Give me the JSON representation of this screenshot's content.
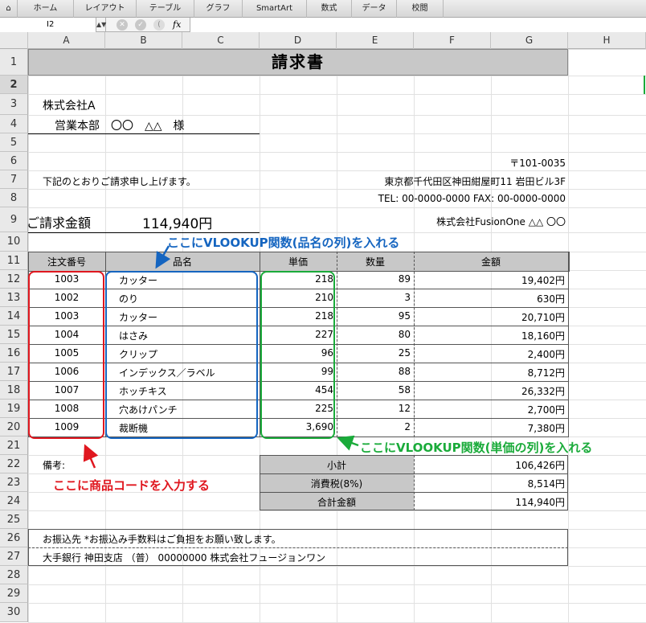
{
  "ribbon": {
    "tabs": [
      "ホーム",
      "レイアウト",
      "テーブル",
      "グラフ",
      "SmartArt",
      "数式",
      "データ",
      "校閲"
    ]
  },
  "formula_bar": {
    "cell_ref": "I2",
    "formula": ""
  },
  "columns": [
    "A",
    "B",
    "C",
    "D",
    "E",
    "F",
    "G",
    "H"
  ],
  "rows": [
    "1",
    "2",
    "3",
    "4",
    "5",
    "6",
    "7",
    "8",
    "9",
    "10",
    "11",
    "12",
    "13",
    "14",
    "15",
    "16",
    "17",
    "18",
    "19",
    "20",
    "21",
    "22",
    "23",
    "24",
    "25",
    "26",
    "27",
    "28",
    "29",
    "30"
  ],
  "selected_row": "2",
  "invoice": {
    "title": "請求書",
    "client_company": "株式会社A",
    "client_dept": "営業本部　〇〇　△△　様",
    "postal": "〒101-0035",
    "intro": "下記のとおりご請求申し上げます。",
    "address": "東京都千代田区神田紺屋町11  岩田ビル3F",
    "tel_fax": "TEL: 00-0000-0000 FAX: 00-0000-0000",
    "total_label": "ご請求金額",
    "total_value": "114,940円",
    "issuer": "株式会社FusionOne  △△  〇〇",
    "headers": {
      "order": "注文番号",
      "name": "品名",
      "price": "単価",
      "qty": "数量",
      "amount": "金額"
    },
    "items": [
      {
        "order": "1003",
        "name": "カッター",
        "price": "218",
        "qty": "89",
        "amount": "19,402円"
      },
      {
        "order": "1002",
        "name": "のり",
        "price": "210",
        "qty": "3",
        "amount": "630円"
      },
      {
        "order": "1003",
        "name": "カッター",
        "price": "218",
        "qty": "95",
        "amount": "20,710円"
      },
      {
        "order": "1004",
        "name": "はさみ",
        "price": "227",
        "qty": "80",
        "amount": "18,160円"
      },
      {
        "order": "1005",
        "name": "クリップ",
        "price": "96",
        "qty": "25",
        "amount": "2,400円"
      },
      {
        "order": "1006",
        "name": "インデックス／ラベル",
        "price": "99",
        "qty": "88",
        "amount": "8,712円"
      },
      {
        "order": "1007",
        "name": "ホッチキス",
        "price": "454",
        "qty": "58",
        "amount": "26,332円"
      },
      {
        "order": "1008",
        "name": "穴あけパンチ",
        "price": "225",
        "qty": "12",
        "amount": "2,700円"
      },
      {
        "order": "1009",
        "name": "裁断機",
        "price": "3,690",
        "qty": "2",
        "amount": "7,380円"
      }
    ],
    "remarks_label": "備考:",
    "subtotal_label": "小計",
    "subtotal_value": "106,426円",
    "tax_label": "消費税(8%)",
    "tax_value": "8,514円",
    "grand_label": "合計金額",
    "grand_value": "114,940円",
    "bank_note": "お振込先  *お振込み手数料はご負担をお願い致します。",
    "bank_info": "大手銀行  神田支店  （普）  00000000  株式会社フュージョンワン"
  },
  "annotations": {
    "blue": "ここにVLOOKUP関数(品名の列)を入れる",
    "green": "ここにVLOOKUP関数(単価の列)を入れる",
    "red": "ここに商品コードを入力する",
    "colors": {
      "blue": "#1565c0",
      "green": "#1aab3a",
      "red": "#e0171f"
    }
  }
}
